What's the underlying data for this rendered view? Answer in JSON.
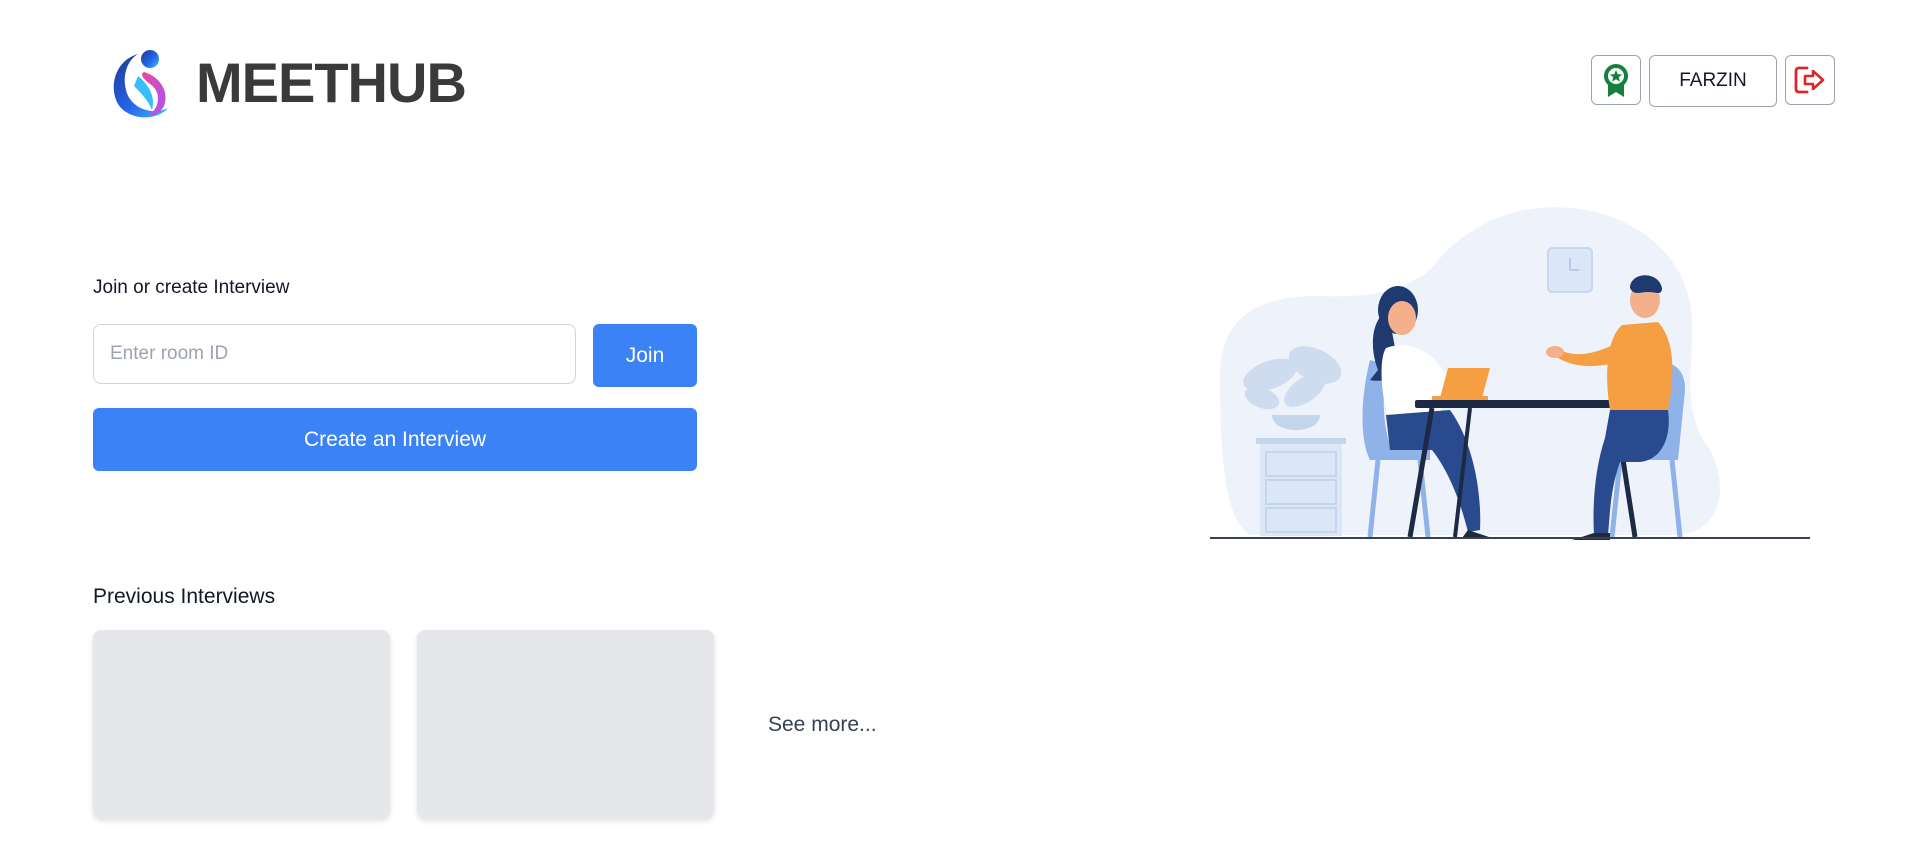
{
  "header": {
    "logo_text": "MEETHUB",
    "logo_icon": "meethub-logo-icon",
    "user_name": "FARZIN",
    "achievements_icon": "award-ribbon-icon",
    "logout_icon": "logout-icon",
    "colors": {
      "award": "#15803d",
      "logout": "#dc2626"
    }
  },
  "join_section": {
    "title": "Join or create Interview",
    "room_input_placeholder": "Enter room ID",
    "room_input_value": "",
    "join_label": "Join",
    "create_label": "Create an Interview"
  },
  "previous": {
    "title": "Previous Interviews",
    "card_count": 2,
    "see_more_label": "See more..."
  },
  "colors": {
    "primary": "#3b82f6",
    "card_placeholder": "#e5e7eb"
  }
}
